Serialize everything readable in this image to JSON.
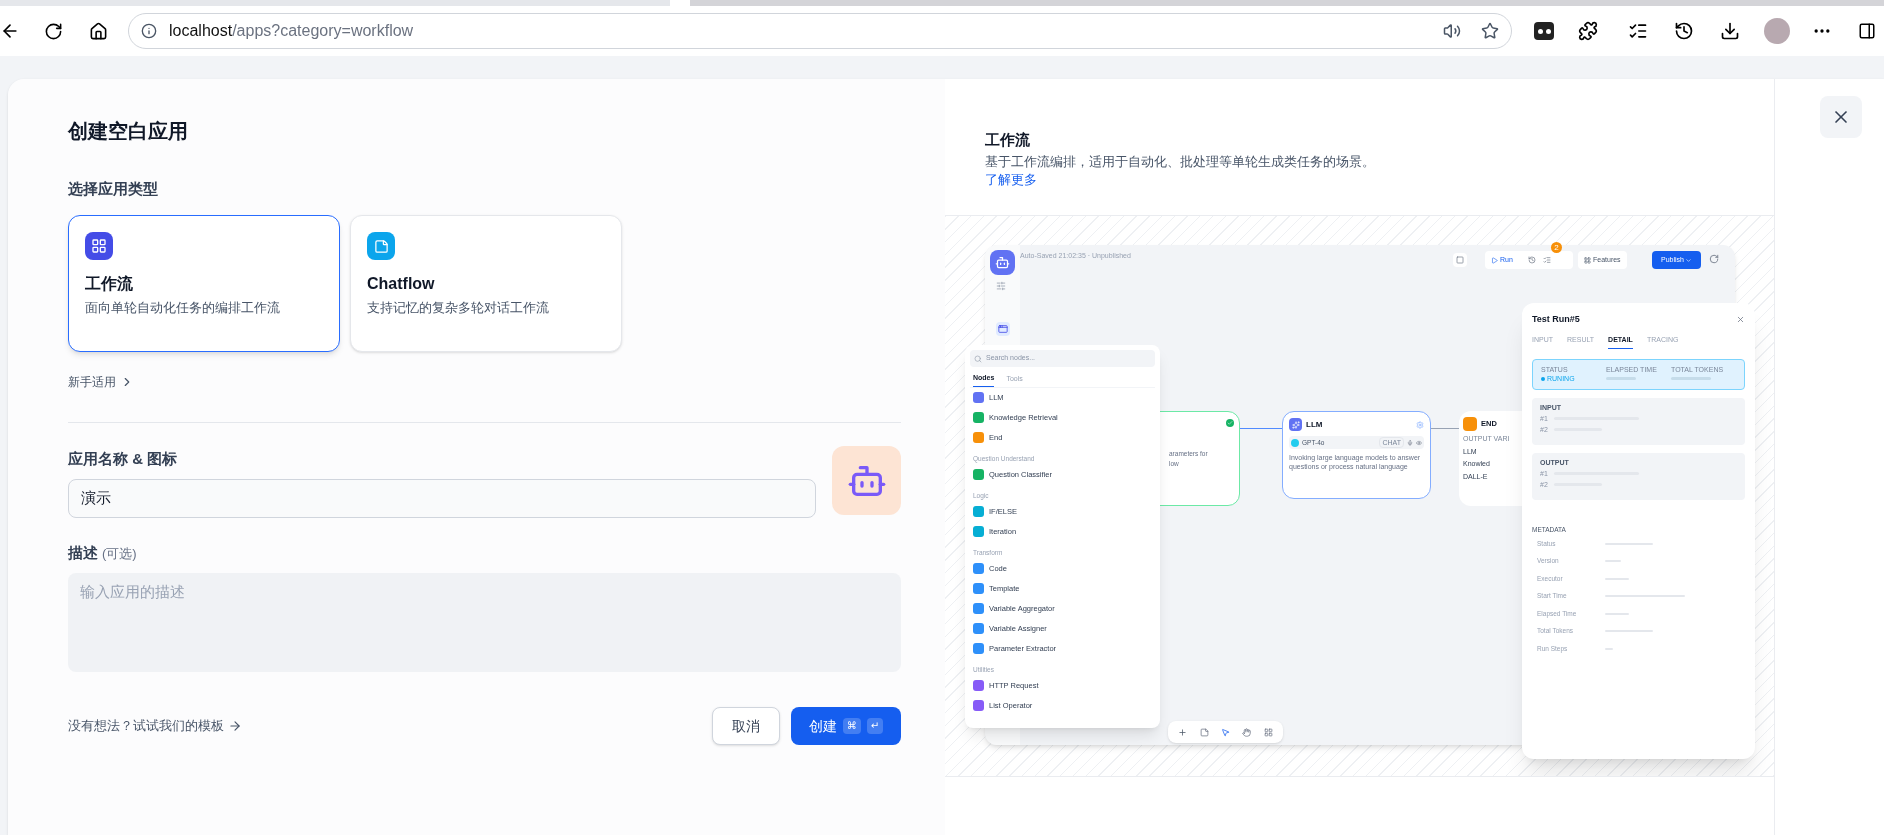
{
  "browser": {
    "url_host": "localhost",
    "url_path": "/apps?category=workflow"
  },
  "dialog": {
    "title": "创建空白应用",
    "type_label": "选择应用类型",
    "app_types": [
      {
        "kind": "workflow",
        "title": "工作流",
        "description": "面向单轮自动化任务的编排工作流",
        "selected": true
      },
      {
        "kind": "chatflow",
        "title": "Chatflow",
        "description": "支持记忆的复杂多轮对话工作流",
        "selected": false
      }
    ],
    "beginner_link": "新手适用",
    "name_label": "应用名称 & 图标",
    "name_value": "演示",
    "description_label": "描述",
    "description_optional": "(可选)",
    "description_placeholder": "输入应用的描述",
    "template_link": "没有想法？试试我们的模板",
    "cancel": "取消",
    "create": {
      "label": "创建",
      "keys": [
        "⌘",
        "↵"
      ]
    }
  },
  "preview": {
    "title": "工作流",
    "description": "基于工作流编排，适用于自动化、批处理等单轮生成类任务的场景。",
    "learn_more": "了解更多",
    "screenshot": {
      "autosave": "Auto-Saved 21:02:35 · Unpublished",
      "run": "Run",
      "badge": "2",
      "features": "Features",
      "publish": "Publish",
      "search_placeholder": "Search nodes...",
      "node_tabs": [
        {
          "label": "Nodes",
          "selected": true
        },
        {
          "label": "Tools",
          "selected": false
        }
      ],
      "node_groups": [
        {
          "items": [
            {
              "label": "LLM",
              "color": "#6172f3"
            },
            {
              "label": "Knowledge Retrieval",
              "color": "#16b364"
            },
            {
              "label": "End",
              "color": "#f79009"
            }
          ]
        },
        {
          "title": "Question Understand",
          "items": [
            {
              "label": "Question Classifier",
              "color": "#16b364"
            }
          ]
        },
        {
          "title": "Logic",
          "items": [
            {
              "label": "IF/ELSE",
              "color": "#06aed4"
            },
            {
              "label": "Iteration",
              "color": "#06aed4"
            }
          ]
        },
        {
          "title": "Transform",
          "items": [
            {
              "label": "Code",
              "color": "#2e90fa"
            },
            {
              "label": "Template",
              "color": "#2e90fa"
            },
            {
              "label": "Variable Aggregator",
              "color": "#2e90fa"
            },
            {
              "label": "Variable Assigner",
              "color": "#2e90fa"
            },
            {
              "label": "Parameter Extractor",
              "color": "#2e90fa"
            }
          ]
        },
        {
          "title": "Utilities",
          "items": [
            {
              "label": "HTTP Request",
              "color": "#875bf7"
            },
            {
              "label": "List Operator",
              "color": "#875bf7"
            }
          ]
        }
      ],
      "start_node": {
        "text_lines": [
          "arameters for",
          "low"
        ]
      },
      "llm_node": {
        "title": "LLM",
        "model": "GPT-4o",
        "tag": "CHAT",
        "description": "Invoking large language models to answer questions or process natural language"
      },
      "end_node": {
        "title": "END",
        "output_label": "OUTPUT VARI",
        "outputs": [
          "LLM",
          "Knowled",
          "DALL-E"
        ]
      },
      "test_run": {
        "title": "Test Run#5",
        "tabs": [
          {
            "label": "INPUT",
            "selected": false
          },
          {
            "label": "RESULT",
            "selected": false
          },
          {
            "label": "DETAIL",
            "selected": true
          },
          {
            "label": "TRACING",
            "selected": false
          }
        ],
        "status_label": "STATUS",
        "status": "RUNING",
        "elapsed_label": "ELAPSED TIME",
        "tokens_label": "TOTAL TOKENS",
        "sections": [
          {
            "title": "INPUT",
            "rows": [
              "#1",
              "#2"
            ]
          },
          {
            "title": "OUTPUT",
            "rows": [
              "#1",
              "#2"
            ]
          }
        ],
        "metadata_title": "METADATA",
        "metadata": [
          "Status",
          "Version",
          "Executor",
          "Start Time",
          "Elapsed Time",
          "Total Tokens",
          "Run Steps"
        ]
      }
    }
  }
}
